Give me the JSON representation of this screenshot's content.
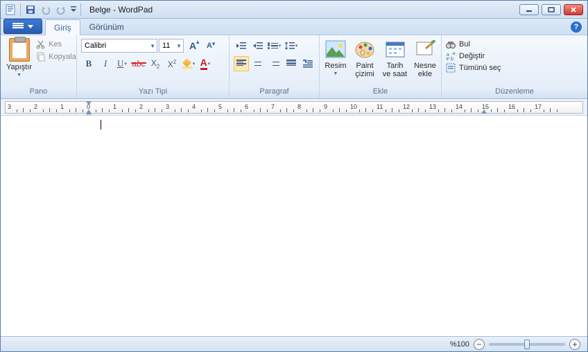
{
  "title": "Belge - WordPad",
  "tabs": {
    "home": "Giriş",
    "view": "Görünüm"
  },
  "groups": {
    "clipboard": {
      "label": "Pano",
      "paste": "Yapıştır",
      "cut": "Kes",
      "copy": "Kopyala"
    },
    "font": {
      "label": "Yazı Tipi",
      "name": "Calibri",
      "size": "11"
    },
    "paragraph": {
      "label": "Paragraf"
    },
    "insert": {
      "label": "Ekle",
      "picture": "Resim",
      "paint": "Paint çizimi",
      "datetime": "Tarih ve saat",
      "object": "Nesne ekle"
    },
    "editing": {
      "label": "Düzenleme",
      "find": "Bul",
      "replace": "Değiştir",
      "selectall": "Tümünü seç"
    }
  },
  "ruler": {
    "start": -3,
    "end": 17,
    "leftMargin": 0,
    "rightMargin": 15
  },
  "status": {
    "zoom": "%100",
    "sliderPos": 50
  }
}
